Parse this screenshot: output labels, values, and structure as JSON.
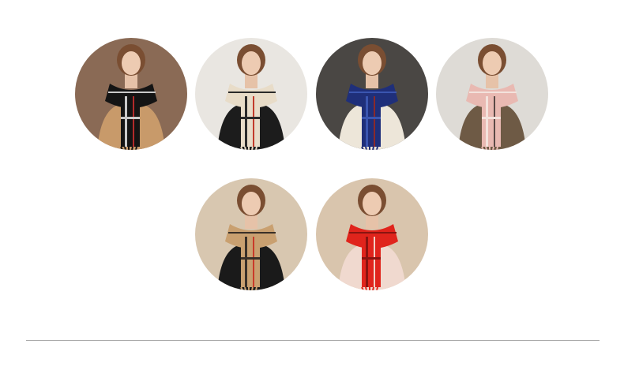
{
  "swatches": [
    {
      "color_name": "black-plaid",
      "scarf_color": "#141414",
      "stripe_color": "#c9c9c9",
      "accent_color": "#b22a2a",
      "background": "#8a6a55",
      "coat_color": "#c89a6a"
    },
    {
      "color_name": "beige-plaid",
      "scarf_color": "#e8dcc8",
      "stripe_color": "#2a2a2a",
      "accent_color": "#c23a2a",
      "background": "#e9e6e1",
      "coat_color": "#1c1c1c"
    },
    {
      "color_name": "navy-plaid",
      "scarf_color": "#1f2f7a",
      "stripe_color": "#3a55b0",
      "accent_color": "#8a2a2a",
      "background": "#4a4744",
      "coat_color": "#ede6d9"
    },
    {
      "color_name": "pink-plaid",
      "scarf_color": "#e9b9b2",
      "stripe_color": "#f3e2dc",
      "accent_color": "#5a4a46",
      "background": "#dedbd6",
      "coat_color": "#6e5a45"
    },
    {
      "color_name": "camel-plaid",
      "scarf_color": "#c9a070",
      "stripe_color": "#3a3028",
      "accent_color": "#c93a2a",
      "background": "#d8c7b0",
      "coat_color": "#1a1a1a"
    },
    {
      "color_name": "red-plaid",
      "scarf_color": "#e0241c",
      "stripe_color": "#8a1410",
      "accent_color": "#f2d2c6",
      "background": "#d9c5ad",
      "coat_color": "#f0d9cf"
    }
  ]
}
